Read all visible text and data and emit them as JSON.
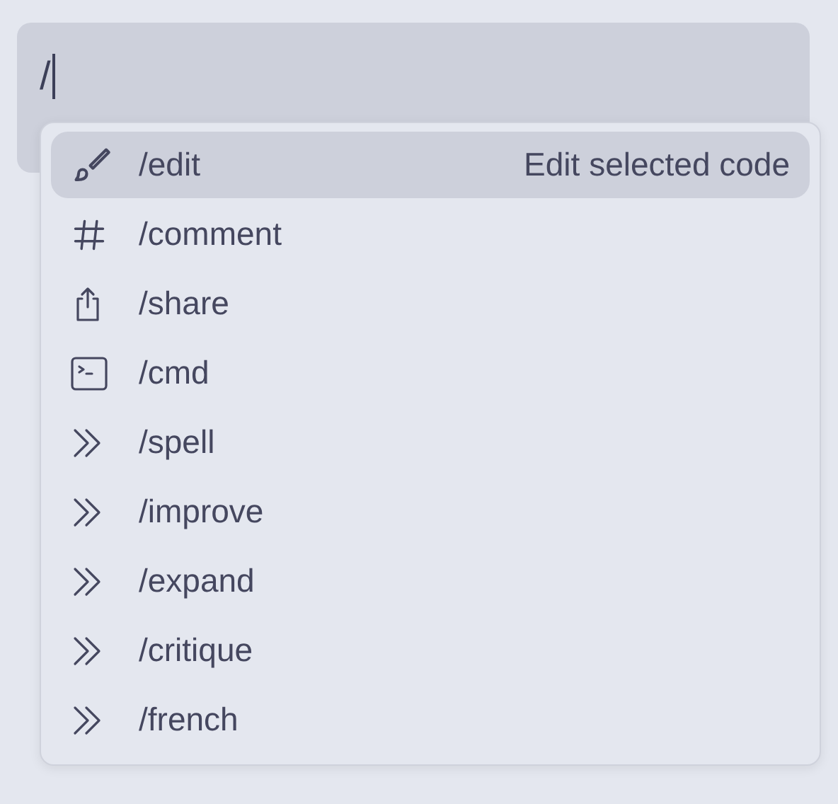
{
  "input": {
    "value": "/"
  },
  "menu": {
    "items": [
      {
        "kind": "brush",
        "label": "/edit",
        "description": "Edit selected code",
        "selected": true
      },
      {
        "kind": "hash",
        "label": "/comment",
        "selected": false
      },
      {
        "kind": "share",
        "label": "/share",
        "selected": false
      },
      {
        "kind": "terminal",
        "label": "/cmd",
        "selected": false
      },
      {
        "kind": "chevrons",
        "label": "/spell",
        "selected": false
      },
      {
        "kind": "chevrons",
        "label": "/improve",
        "selected": false
      },
      {
        "kind": "chevrons",
        "label": "/expand",
        "selected": false
      },
      {
        "kind": "chevrons",
        "label": "/critique",
        "selected": false
      },
      {
        "kind": "chevrons",
        "label": "/french",
        "selected": false
      }
    ]
  }
}
